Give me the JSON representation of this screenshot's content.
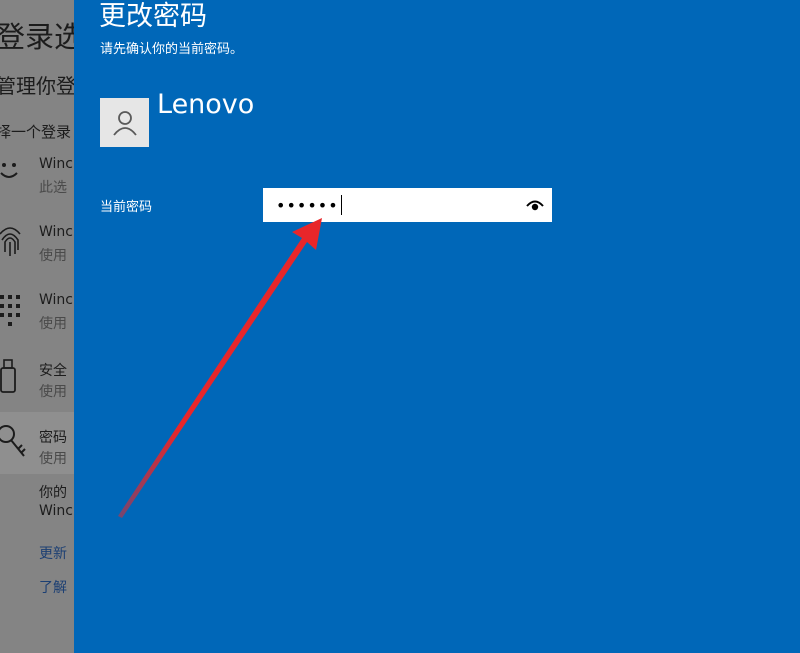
{
  "background": {
    "page_title": "登录选",
    "subtitle": "管理你登",
    "choose_text": "择一个登录",
    "options": [
      {
        "title": "Winc",
        "desc": "此选",
        "icon": "smiley-face-icon"
      },
      {
        "title": "Winc",
        "desc": "使用",
        "icon": "fingerprint-icon"
      },
      {
        "title": "Winc",
        "desc": "使用",
        "icon": "pin-keypad-icon"
      },
      {
        "title": "安全",
        "desc": "使用",
        "icon": "security-key-icon"
      },
      {
        "title": "密码",
        "desc": "使用",
        "icon": "key-icon"
      }
    ],
    "password_detail_1": "你的",
    "password_detail_2": "Winc",
    "link_update": "更新",
    "link_learn": "了解"
  },
  "dialog": {
    "title": "更改密码",
    "instruction": "请先确认你的当前密码。",
    "username": "Lenovo",
    "field_label": "当前密码",
    "password_value": "••••••",
    "reveal_icon": "eye-reveal-icon"
  },
  "annotation": {
    "arrow_color": "#e8262a"
  },
  "colors": {
    "dialog_bg": "#0067b8",
    "dim_bg": "#848484"
  }
}
